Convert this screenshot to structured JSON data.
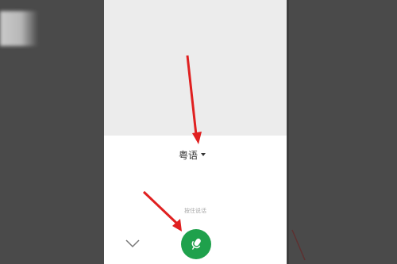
{
  "voice_input": {
    "language_label": "粤语",
    "hint_text": "按住说话"
  },
  "icons": {
    "dropdown": "caret-down-icon",
    "collapse": "chevron-down-icon",
    "microphone": "microphone-icon"
  },
  "colors": {
    "accent": "#1fa14c",
    "annotation_arrow": "#e02020",
    "backdrop": "#4a4a4a",
    "panel_top": "#ececec"
  }
}
